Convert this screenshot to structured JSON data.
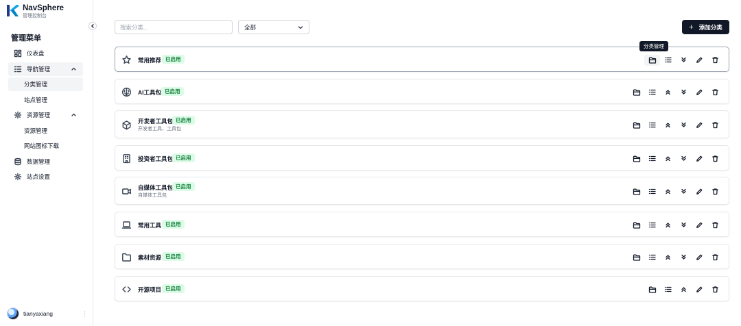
{
  "brand": {
    "title": "NavSphere",
    "subtitle": "管理控制台"
  },
  "sidebar": {
    "menu_title": "管理菜单",
    "items": [
      {
        "label": "仪表盘",
        "icon": "dashboard-icon"
      },
      {
        "label": "导航管理",
        "icon": "navigation-icon",
        "expanded": true,
        "children": [
          {
            "label": "分类管理",
            "active": true
          },
          {
            "label": "站点管理"
          }
        ]
      },
      {
        "label": "资源管理",
        "icon": "resource-gear-icon",
        "expanded": true,
        "children": [
          {
            "label": "资源管理"
          },
          {
            "label": "网站图标下载"
          }
        ]
      },
      {
        "label": "数据管理",
        "icon": "database-icon"
      },
      {
        "label": "站点设置",
        "icon": "settings-gear-icon"
      }
    ],
    "user": {
      "name": "tianyaxiang"
    }
  },
  "toolbar": {
    "search_placeholder": "搜索分类...",
    "filter_value": "全部",
    "add_button": "添加分类"
  },
  "tooltip": "分类管理",
  "colors": {
    "primary": "#111827",
    "badge_bg": "#dcfce7",
    "badge_text": "#15803d",
    "border": "#e5e7eb"
  },
  "categories": [
    {
      "name": "常用推荐",
      "status": "已启用",
      "description": "",
      "icon": "star-icon",
      "move_up": false,
      "move_down": true
    },
    {
      "name": "AI工具包",
      "status": "已启用",
      "description": "",
      "icon": "brain-icon",
      "move_up": true,
      "move_down": true
    },
    {
      "name": "开发者工具包",
      "status": "已启用",
      "description": "开发者工具、工具包",
      "icon": "package-box-icon",
      "move_up": true,
      "move_down": true
    },
    {
      "name": "投资者工具包",
      "status": "已启用",
      "description": "",
      "icon": "building-icon",
      "move_up": true,
      "move_down": true
    },
    {
      "name": "自媒体工具包",
      "status": "已启用",
      "description": "自媒体工具包",
      "icon": "video-camera-icon",
      "move_up": true,
      "move_down": true
    },
    {
      "name": "常用工具",
      "status": "已启用",
      "description": "",
      "icon": "laptop-icon",
      "move_up": true,
      "move_down": true
    },
    {
      "name": "素材资源",
      "status": "已启用",
      "description": "",
      "icon": "folder-icon",
      "move_up": true,
      "move_down": true
    },
    {
      "name": "开源项目",
      "status": "已启用",
      "description": "",
      "icon": "code-brackets-icon",
      "move_up": true,
      "move_down": false
    }
  ]
}
